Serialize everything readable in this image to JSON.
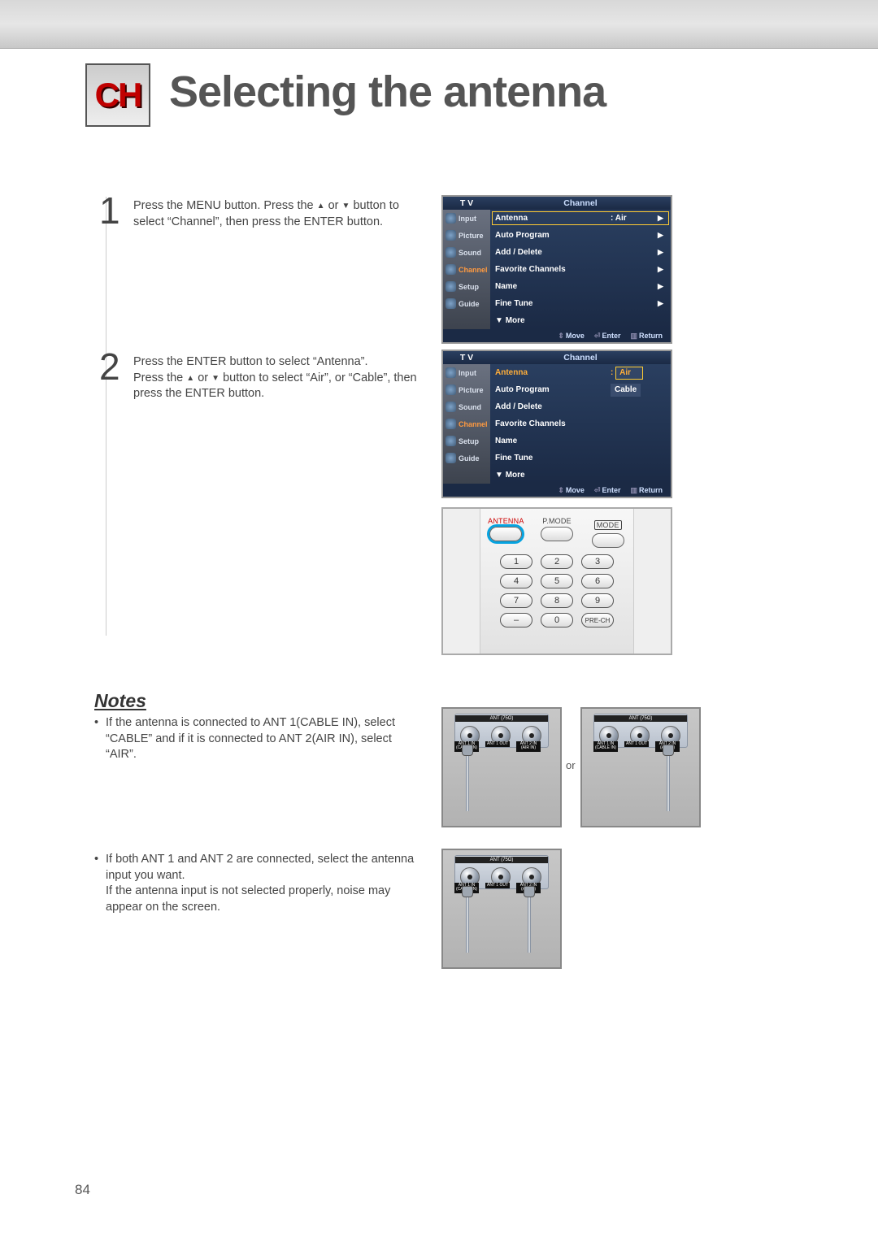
{
  "badge": "CH",
  "title": "Selecting the antenna",
  "steps": [
    {
      "num": "1",
      "text_pre": "Press the MENU button. Press the ",
      "text_mid": " or ",
      "text_post": " button to select “Channel”, then press the ENTER button."
    },
    {
      "num": "2",
      "text_a": "Press the ENTER button to select “Antenna”.",
      "text_b_pre": "Press the ",
      "text_b_mid": " or ",
      "text_b_post": " button to select “Air”, or “Cable”, then press the ENTER button."
    }
  ],
  "osd_side": [
    {
      "label": "Input"
    },
    {
      "label": "Picture"
    },
    {
      "label": "Sound"
    },
    {
      "label": "Channel"
    },
    {
      "label": "Setup"
    },
    {
      "label": "Guide"
    }
  ],
  "osd": {
    "tv": "T V",
    "channel": "Channel",
    "more": "More",
    "foot_move": "Move",
    "foot_enter": "Enter",
    "foot_return": "Return"
  },
  "osd1_rows": [
    {
      "label": "Antenna",
      "val": ": Air",
      "arrow": "▶",
      "boxed": true
    },
    {
      "label": "Auto Program",
      "val": "",
      "arrow": "▶"
    },
    {
      "label": "Add / Delete",
      "val": "",
      "arrow": "▶"
    },
    {
      "label": "Favorite Channels",
      "val": "",
      "arrow": "▶"
    },
    {
      "label": "Name",
      "val": "",
      "arrow": "▶"
    },
    {
      "label": "Fine Tune",
      "val": "",
      "arrow": "▶"
    }
  ],
  "osd2_rows": [
    {
      "label": "Antenna",
      "val": ":",
      "opt": "Air",
      "boxed": true,
      "sel": true
    },
    {
      "label": "Auto Program",
      "val": "",
      "opt": "Cable"
    },
    {
      "label": "Add / Delete",
      "val": ""
    },
    {
      "label": "Favorite Channels",
      "val": ""
    },
    {
      "label": "Name",
      "val": ""
    },
    {
      "label": "Fine Tune",
      "val": ""
    }
  ],
  "remote": {
    "top": [
      {
        "label": "ANTENNA",
        "style": "red",
        "circled": true
      },
      {
        "label": "P.MODE"
      },
      {
        "label": "MODE",
        "style": "boxed"
      }
    ],
    "keys": [
      "1",
      "2",
      "3",
      "4",
      "5",
      "6",
      "7",
      "8",
      "9",
      "–",
      "0",
      "PRE-CH"
    ]
  },
  "notes_title": "Notes",
  "notes": [
    "If the antenna is connected to ANT 1(CABLE IN), select “CABLE” and if it is connected to ANT 2(AIR IN), select “AIR”.",
    "If both ANT 1 and ANT 2 are connected, select the antenna input you want.\nIf the antenna input is not selected properly, noise may appear on the screen."
  ],
  "or_label": "or",
  "ant_panel": {
    "title": "ANT (75Ω)",
    "labels": [
      "ANT 1 IN\n(CABLE IN)",
      "ANT 1 OUT",
      "ANT 2 IN\n(AIR IN)"
    ]
  },
  "page_number": "84"
}
